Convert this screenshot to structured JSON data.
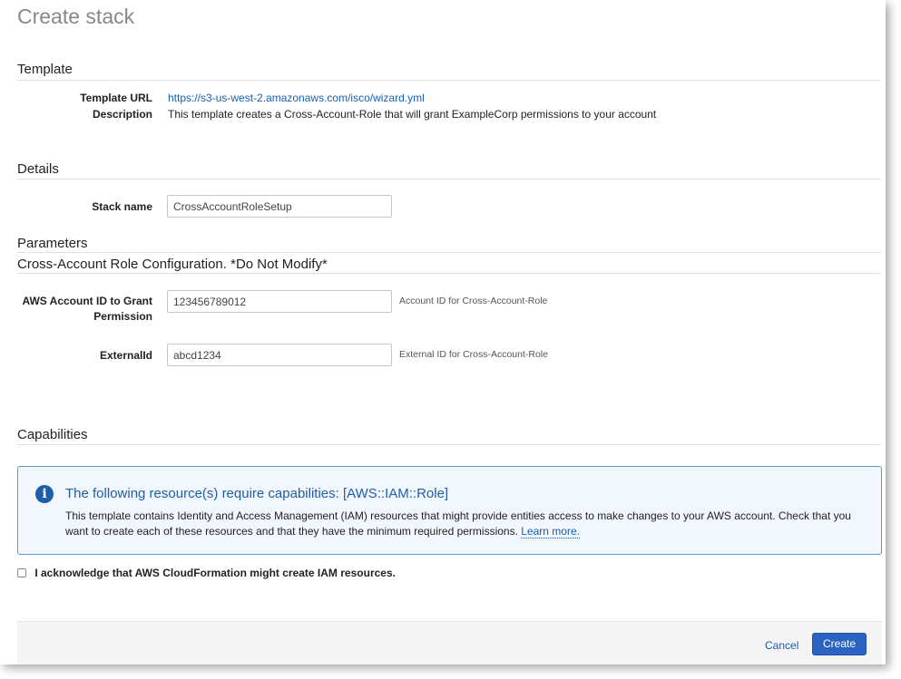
{
  "page": {
    "title": "Create stack"
  },
  "template": {
    "section_title": "Template",
    "url_label": "Template URL",
    "url_value": "https://s3-us-west-2.amazonaws.com/isco/wizard.yml",
    "description_label": "Description",
    "description_value": "This template creates a Cross-Account-Role that will grant ExampleCorp permissions to your account"
  },
  "details": {
    "section_title": "Details",
    "stack_name_label": "Stack name",
    "stack_name_value": "CrossAccountRoleSetup"
  },
  "parameters": {
    "section_title": "Parameters",
    "group_title": "Cross-Account Role Configuration. *Do Not Modify*",
    "account_id_label": "AWS Account ID to Grant Permission",
    "account_id_value": "123456789012",
    "account_id_hint": "Account ID for Cross-Account-Role",
    "external_id_label": "ExternalId",
    "external_id_value": "abcd1234",
    "external_id_hint": "External ID for Cross-Account-Role"
  },
  "capabilities": {
    "section_title": "Capabilities",
    "info_title": "The following resource(s) require capabilities: [AWS::IAM::Role]",
    "info_text": "This template contains Identity and Access Management (IAM) resources that might provide entities access to make changes to your AWS account. Check that you want to create each of these resources and that they have the minimum required permissions.",
    "learn_more": "Learn more.",
    "ack_label": "I acknowledge that AWS CloudFormation might create IAM resources.",
    "ack_checked": false
  },
  "footer": {
    "cancel_label": "Cancel",
    "create_label": "Create"
  },
  "colors": {
    "accent": "#1f5da8",
    "link": "#1a5fb4",
    "info_border": "#5b9bd5",
    "info_bg": "#f1f7fc",
    "primary_button": "#2a63c2"
  },
  "icons": {
    "info": "info-circle-icon"
  }
}
